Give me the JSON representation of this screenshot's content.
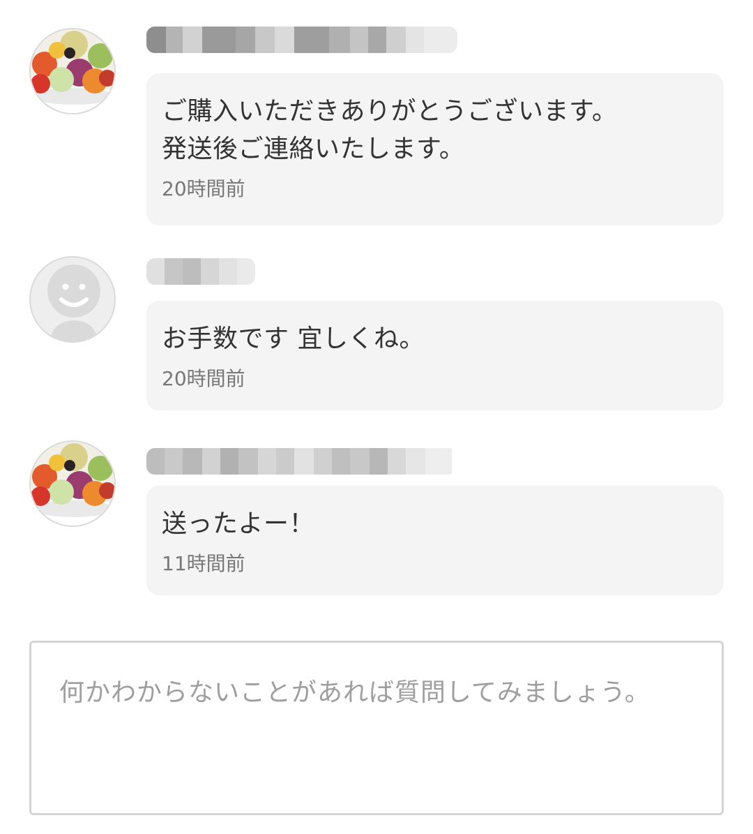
{
  "messages": [
    {
      "avatar": "fruit-bowl-photo",
      "sender_name": "",
      "text": "ご購入いただきありがとうございます。\n発送後ご連絡いたします。",
      "time": "20時間前"
    },
    {
      "avatar": "default-user-icon",
      "sender_name": "",
      "text": "お手数です 宜しくね。",
      "time": "20時間前"
    },
    {
      "avatar": "fruit-bowl-photo",
      "sender_name": "",
      "text": "送ったよー！",
      "time": "11時間前"
    }
  ],
  "comment_input": {
    "value": "",
    "placeholder": "何かわからないことがあれば質問してみましょう。"
  },
  "colors": {
    "bubble_bg": "#f4f4f4",
    "timestamp": "#777777",
    "placeholder": "#9e9e9e",
    "input_border": "#d4d4d4"
  }
}
